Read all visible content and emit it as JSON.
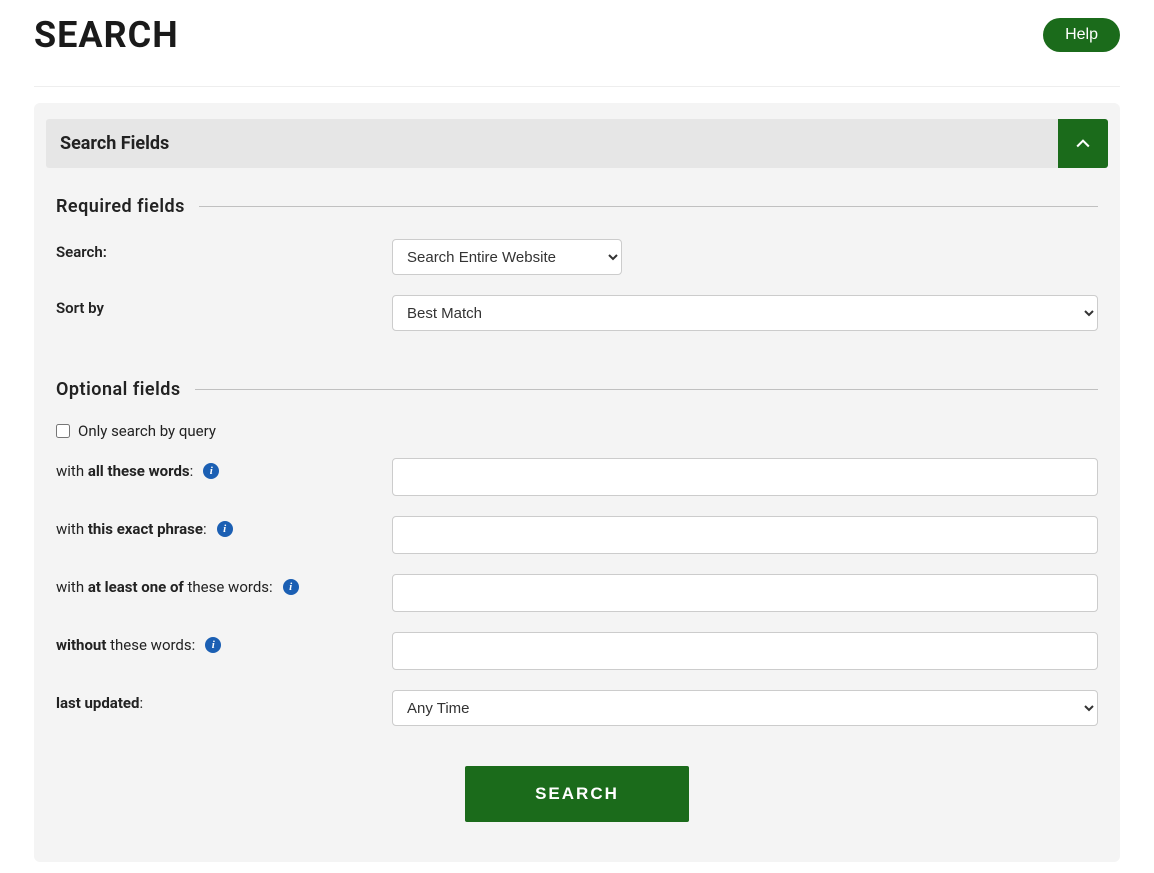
{
  "header": {
    "title": "SEARCH",
    "help_label": "Help"
  },
  "section": {
    "title": "Search Fields"
  },
  "required": {
    "legend": "Required fields",
    "search_label": "Search:",
    "search_select_value": "Search Entire Website",
    "sort_label": "Sort by",
    "sort_select_value": "Best Match"
  },
  "optional": {
    "legend": "Optional fields",
    "only_query_label": "Only search by query",
    "all_words": {
      "prefix": "with ",
      "bold": "all these words",
      "suffix": ":"
    },
    "exact_phrase": {
      "prefix": "with ",
      "bold": "this exact phrase",
      "suffix": ":"
    },
    "one_of": {
      "prefix": "with ",
      "bold": "at least one of",
      "suffix": " these words:"
    },
    "without": {
      "bold": "without",
      "suffix": " these words:"
    },
    "last_updated": {
      "bold": "last updated",
      "suffix": ":"
    },
    "last_updated_value": "Any Time"
  },
  "submit_label": "SEARCH"
}
